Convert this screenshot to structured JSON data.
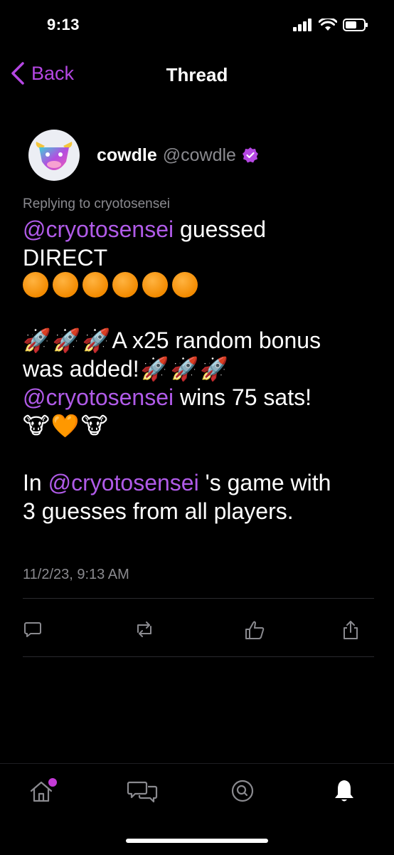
{
  "status_bar": {
    "time": "9:13"
  },
  "nav": {
    "back_label": "Back",
    "title": "Thread"
  },
  "post": {
    "author_name": "cowdle",
    "author_handle": "@cowdle",
    "reply_to": "Replying to cryotosensei",
    "line1_mention": "@cryotosensei",
    "line1_text": " guessed",
    "line2_text": "DIRECT",
    "orange_circles": 6,
    "bonus_text_a": " A x25 random bonus",
    "bonus_text_b": "was added! ",
    "win_mention": "@cryotosensei",
    "win_text": " wins 75 sats!",
    "game_prefix": "In ",
    "game_mention": "@cryotosensei",
    "game_text": " 's game with",
    "game_text2": "3 guesses from all players.",
    "timestamp": "11/2/23, 9:13 AM"
  },
  "colors": {
    "accent": "#b547e3",
    "mention": "#b05be8",
    "muted": "#8a8a8f"
  }
}
